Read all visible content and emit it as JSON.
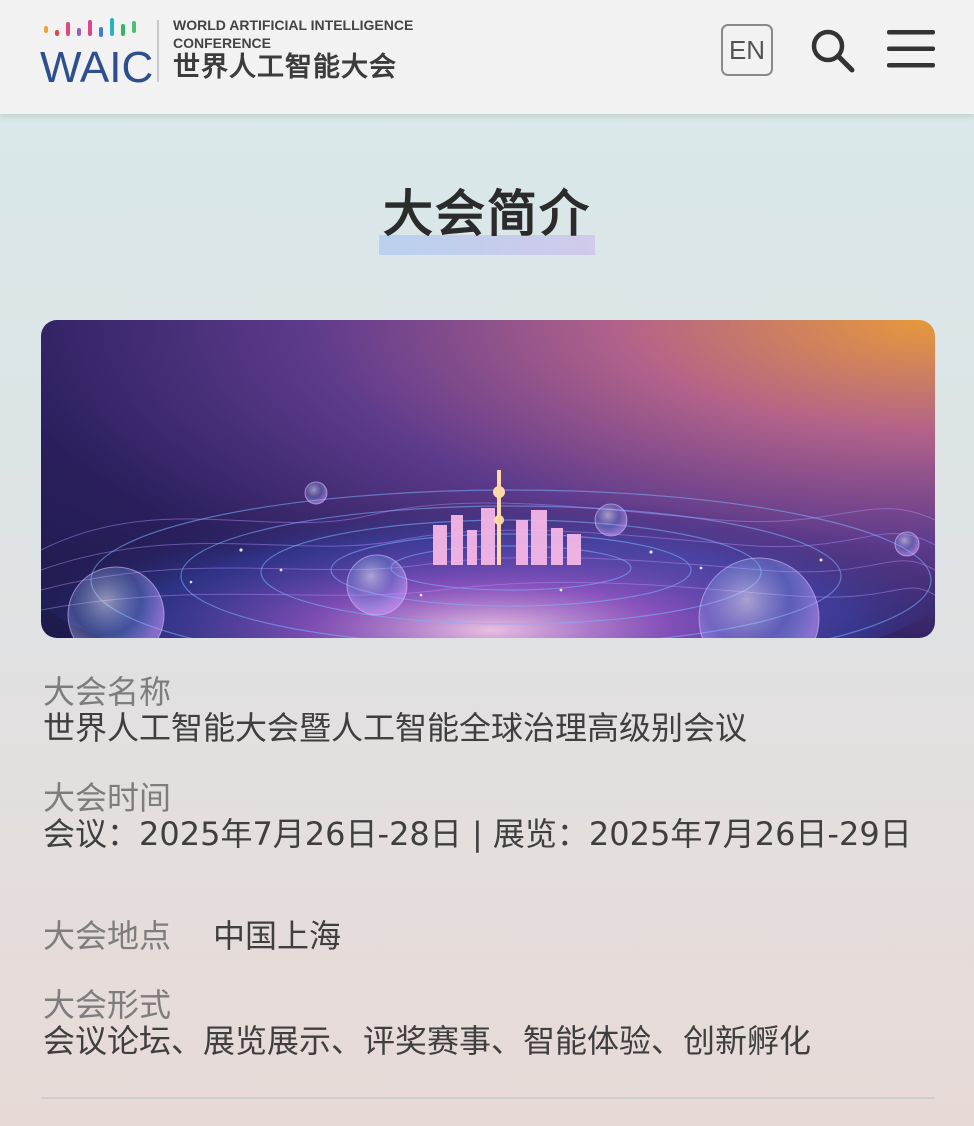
{
  "header": {
    "logo_wordmark": "WAIC",
    "logo_en": "World Artificial Intelligence Conference",
    "logo_cn": "世界人工智能大会",
    "lang_button": "EN"
  },
  "section": {
    "title": "大会简介"
  },
  "info": {
    "name_label": "大会名称",
    "name_value": "世界人工智能大会暨人工智能全球治理高级别会议",
    "time_label": "大会时间",
    "time_value": "会议：2025年7月26日-28日 | 展览：2025年7月26日-29日",
    "place_label": "大会地点",
    "place_value": "中国上海",
    "form_label": "大会形式",
    "form_value": "会议论坛、展览展示、评奖赛事、智能体验、创新孵化"
  },
  "colors": {
    "brand_blue": "#2d4f8d",
    "header_bg": "#f2f2f2",
    "label_gray": "#7d7d7d",
    "value_dark": "#3f3f3f"
  },
  "icons": {
    "search": "search-icon",
    "menu": "hamburger-menu-icon"
  }
}
